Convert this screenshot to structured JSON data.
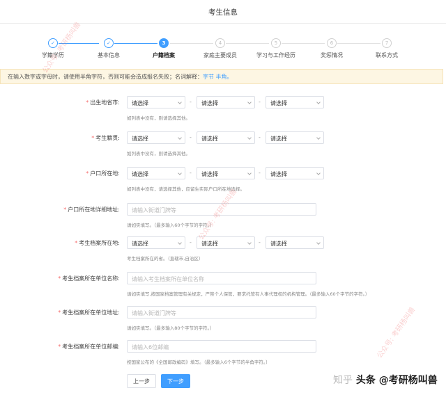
{
  "page_title": "考生信息",
  "steps": [
    {
      "num": "✓",
      "label": "学籍学历",
      "state": "done"
    },
    {
      "num": "✓",
      "label": "基本信息",
      "state": "done"
    },
    {
      "num": "3",
      "label": "户籍档案",
      "state": "active"
    },
    {
      "num": "4",
      "label": "家庭主要成员",
      "state": "todo"
    },
    {
      "num": "5",
      "label": "学习与工作经历",
      "state": "todo"
    },
    {
      "num": "6",
      "label": "奖惩情况",
      "state": "todo"
    },
    {
      "num": "7",
      "label": "联系方式",
      "state": "todo"
    }
  ],
  "notice": {
    "text": "在输入数字或字母时，请使用半角字符，否则可能会造成报名失败；名词解释：",
    "link": "字节 半角。"
  },
  "form": {
    "birthplace": {
      "label": "出生地省市:",
      "hint": "如列表中没有，则请选择其他。"
    },
    "native_place": {
      "label": "考生籍贯:",
      "hint": "如列表中没有，则请选择其他。"
    },
    "hukou": {
      "label": "户口所在地:",
      "hint": "如列表中没有，请选择其他，应留生实际户口所在地选择。"
    },
    "hukou_address": {
      "label": "户口所在地详细地址:",
      "placeholder": "请输入街道门牌等",
      "hint": "请如实填写。（最多输入60个字节的字符。）"
    },
    "archive_location": {
      "label": "考生档案所在地:",
      "hint": "考生档案所在的省。（直辖市,自治区）"
    },
    "archive_unit_name": {
      "label": "考生档案所在单位名称:",
      "placeholder": "请输入考生档案所在单位名称",
      "hint": "请如实填写,按国家档案管理有关规定，严禁个人保管，要求托管有人事代理权的机构管理。（最多输入60个字节的字符。）"
    },
    "archive_unit_address": {
      "label": "考生档案所在单位地址:",
      "placeholder": "请输入街道门牌等",
      "hint": "请如实填写。（最多输入80个字节的字符。）"
    },
    "archive_unit_postcode": {
      "label": "考生档案所在单位邮编:",
      "placeholder": "请输入6位邮编",
      "hint": "按国家公布的《全国邮政编码》填写。（最多输入6个字节的半角字符。）"
    },
    "select_placeholder": "请选择",
    "dash": "-"
  },
  "buttons": {
    "prev": "上一步",
    "next": "下一步"
  },
  "watermarks": {
    "a": "公众号: 考研杨叫兽",
    "b": "公众号: 考研杨叫兽",
    "c": "公众号: 考研杨叫兽"
  },
  "footer": {
    "faint": "知乎",
    "strong": "头条 @考研杨叫兽"
  },
  "colors": {
    "primary": "#409eff",
    "required": "#f56c6c",
    "notice_bg": "#fdf6e3"
  }
}
